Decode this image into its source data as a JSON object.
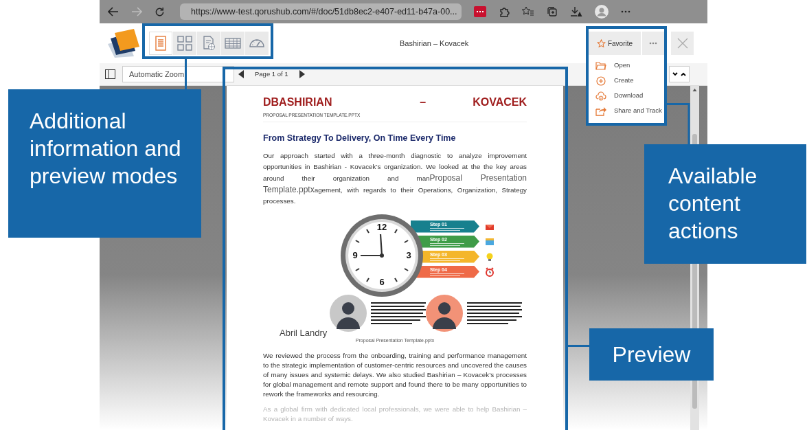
{
  "browser": {
    "url": "https://www-test.qorushub.com/#/doc/51db8ec2-e407-ed11-b47a-00...",
    "forward_disabled": true
  },
  "header": {
    "title": "Bashirian – Kovacek",
    "view_modes": [
      {
        "kind": "document",
        "selected": true
      },
      {
        "kind": "grid",
        "selected": false
      },
      {
        "kind": "web",
        "selected": false
      },
      {
        "kind": "table",
        "selected": false
      },
      {
        "kind": "gauge",
        "selected": false
      }
    ],
    "favorite": "Favorite",
    "menu_items": [
      {
        "kind": "open",
        "label": "Open"
      },
      {
        "kind": "create",
        "label": "Create"
      },
      {
        "kind": "download",
        "label": "Download"
      },
      {
        "kind": "share",
        "label": "Share and Track"
      }
    ]
  },
  "toolbar": {
    "zoom": "Automatic Zoom",
    "page": "Page 1 of 1"
  },
  "document": {
    "title_left": "DBASHIRIAN",
    "title_dash": "–",
    "title_right": "KOVACEK",
    "subtitle": "PROPOSAL PRESENTATION TEMPLATE.PPTX",
    "heading": "From Strategy To Delivery, On Time Every Time",
    "intro": [
      {
        "kind": "normal",
        "text": "Our approach started with a three-month diagnostic to analyze improvement opportunities in Bashirian - Kovacek’s organization. We looked at the the key areas around their organization and man"
      },
      {
        "kind": "large",
        "text": "Proposal Presentation Template.pptx"
      },
      {
        "kind": "normal",
        "text": "agement, with regards to their Operations, Organization, Strategy processes."
      }
    ],
    "clock_numbers": [
      "12",
      "3",
      "6",
      "9"
    ],
    "steps": [
      {
        "title": "Step 01",
        "color": "#17808e"
      },
      {
        "title": "Step 02",
        "color": "#3f9c48"
      },
      {
        "title": "Step 03",
        "color": "#f4b62a"
      },
      {
        "title": "Step 04",
        "color": "#ef6a47"
      }
    ],
    "people": [
      {
        "color": "#c8c8c8"
      },
      {
        "color": "#f29277"
      }
    ],
    "signature": "Abril Landry",
    "caption": "Proposal Presentation Template.pptx",
    "paragraphs": [
      {
        "text": "We reviewed the process from the onboarding, training and performance management to the strategic implementation of customer-centric resources and uncovered the causes of many issues and systemic delays. We also studied Bashirian – Kovacek’s processes for global management and remote support and found there to be many opportunities to rework the frameworks and resourcing.",
        "faded": false
      },
      {
        "text": "As a global firm with dedicated local professionals, we were able to help Bashirian – Kovacek in a number of ways.",
        "faded": true
      }
    ]
  },
  "callouts": [
    {
      "text": "Additional information and preview modes"
    },
    {
      "text": "Available content actions"
    },
    {
      "text": "Preview"
    }
  ]
}
